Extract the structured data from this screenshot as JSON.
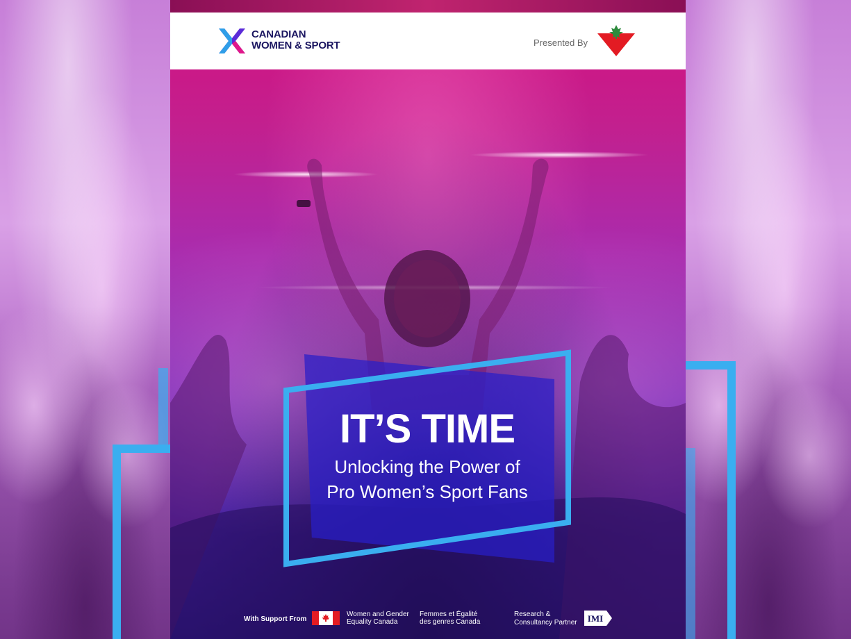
{
  "header": {
    "org_line1": "CANADIAN",
    "org_line2": "WOMEN & SPORT",
    "presented_by": "Presented By",
    "sponsor_logo": "canadian-tire-triangle-logo"
  },
  "cover": {
    "title": "IT’S TIME",
    "subtitle_line1": "Unlocking the Power of",
    "subtitle_line2": "Pro Women’s Sport Fans"
  },
  "footer": {
    "support_label": "With Support From",
    "wage_line1": "Women and Gender",
    "wage_line2": "Equality Canada",
    "femmes_line1": "Femmes et Égalité",
    "femmes_line2": "des genres Canada",
    "research_line1": "Research &",
    "research_line2": "Consultancy Partner",
    "partner_logo_text": "IMI"
  },
  "colors": {
    "accent_blue": "#3aaef0",
    "navy": "#1a1560",
    "magenta": "#d4117e",
    "purple": "#7a2ab8",
    "red": "#e31b23"
  }
}
